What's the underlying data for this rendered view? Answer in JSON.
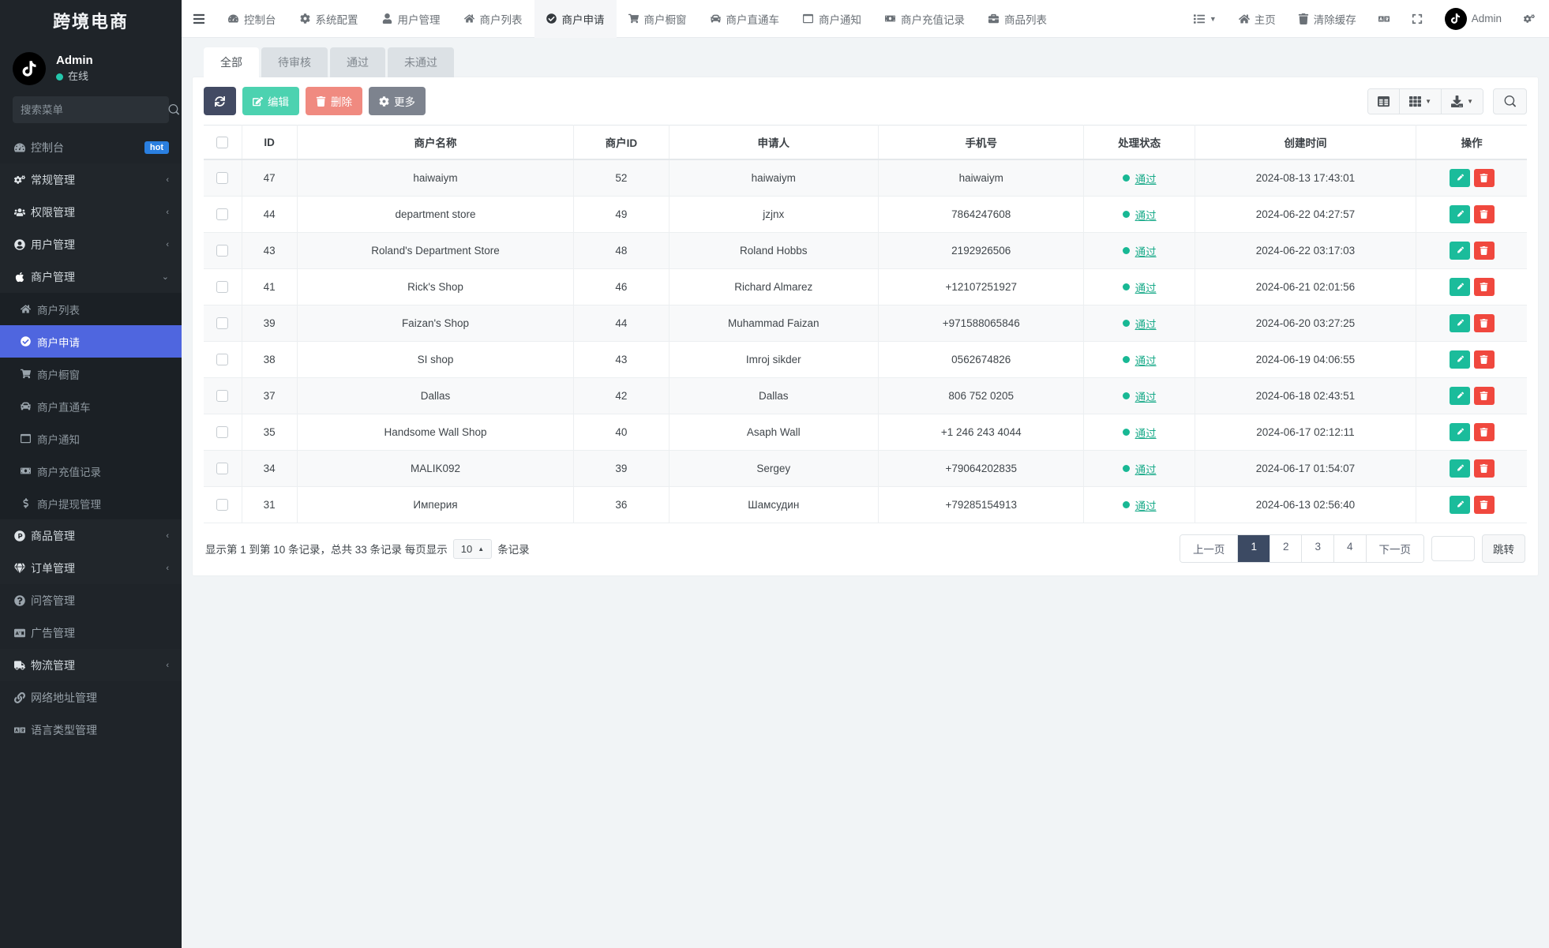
{
  "brand": {
    "title": "跨境电商"
  },
  "user": {
    "name": "Admin",
    "status": "在线",
    "avatar_icon": "tiktok-logo-icon"
  },
  "search": {
    "placeholder": "搜索菜单",
    "value": ""
  },
  "sidebar": {
    "items": [
      {
        "label": "控制台",
        "icon": "dashboard-icon",
        "badge": "hot",
        "type": "item"
      },
      {
        "label": "常规管理",
        "icon": "cogs-icon",
        "caret": "‹",
        "type": "group"
      },
      {
        "label": "权限管理",
        "icon": "users-icon",
        "caret": "‹",
        "type": "group"
      },
      {
        "label": "用户管理",
        "icon": "user-circle-icon",
        "caret": "‹",
        "type": "group"
      },
      {
        "label": "商户管理",
        "icon": "apple-icon",
        "caret": "⌄",
        "type": "group-open"
      },
      {
        "label": "商户列表",
        "icon": "home-icon",
        "type": "sub"
      },
      {
        "label": "商户申请",
        "icon": "check-circle-icon",
        "type": "sub-active"
      },
      {
        "label": "商户橱窗",
        "icon": "cart-icon",
        "type": "sub"
      },
      {
        "label": "商户直通车",
        "icon": "car-icon",
        "type": "sub"
      },
      {
        "label": "商户通知",
        "icon": "window-icon",
        "type": "sub"
      },
      {
        "label": "商户充值记录",
        "icon": "money-icon",
        "type": "sub"
      },
      {
        "label": "商户提现管理",
        "icon": "dollar-icon",
        "type": "sub"
      },
      {
        "label": "商品管理",
        "icon": "p-circle-icon",
        "caret": "‹",
        "type": "group"
      },
      {
        "label": "订单管理",
        "icon": "gem-icon",
        "caret": "‹",
        "type": "group"
      },
      {
        "label": "问答管理",
        "icon": "question-circle-icon",
        "type": "item"
      },
      {
        "label": "广告管理",
        "icon": "ad-icon",
        "type": "item"
      },
      {
        "label": "物流管理",
        "icon": "truck-icon",
        "caret": "‹",
        "type": "group"
      },
      {
        "label": "网络地址管理",
        "icon": "link-icon",
        "type": "item"
      },
      {
        "label": "语言类型管理",
        "icon": "language-icon",
        "type": "item"
      }
    ]
  },
  "topnav": {
    "menu_icon": "hamburger-icon",
    "tabs": [
      {
        "label": "控制台",
        "icon": "dashboard-icon",
        "active": false
      },
      {
        "label": "系统配置",
        "icon": "gear-icon",
        "active": false
      },
      {
        "label": "用户管理",
        "icon": "user-icon",
        "active": false
      },
      {
        "label": "商户列表",
        "icon": "home-icon",
        "active": false
      },
      {
        "label": "商户申请",
        "icon": "check-circle-icon",
        "active": true
      },
      {
        "label": "商户橱窗",
        "icon": "cart-icon",
        "active": false
      },
      {
        "label": "商户直通车",
        "icon": "car-icon",
        "active": false
      },
      {
        "label": "商户通知",
        "icon": "window-icon",
        "active": false
      },
      {
        "label": "商户充值记录",
        "icon": "money-icon",
        "active": false
      },
      {
        "label": "商品列表",
        "icon": "briefcase-icon",
        "active": false
      }
    ],
    "right": {
      "list_label": "",
      "home_label": "主页",
      "clear_cache_label": "清除缓存",
      "lang_icon": "language-icon",
      "fullscreen_icon": "expand-icon",
      "admin_label": "Admin",
      "settings_icon": "cogs-icon"
    }
  },
  "tabs": [
    {
      "label": "全部",
      "active": true
    },
    {
      "label": "待审核",
      "active": false
    },
    {
      "label": "通过",
      "active": false
    },
    {
      "label": "未通过",
      "active": false
    }
  ],
  "toolbar": {
    "refresh_icon": "refresh-icon",
    "edit_label": "编辑",
    "delete_label": "删除",
    "more_label": "更多",
    "column_icon": "columns-icon",
    "grid_icon": "grid-icon",
    "export_icon": "export-icon",
    "search_icon": "search-icon"
  },
  "table": {
    "columns": [
      "",
      "ID",
      "商户名称",
      "商户ID",
      "申请人",
      "手机号",
      "处理状态",
      "创建时间",
      "操作"
    ],
    "rows": [
      {
        "id": "47",
        "name": "haiwaiym",
        "merchant_id": "52",
        "applicant": "haiwaiym",
        "phone": "haiwaiym",
        "status": "通过",
        "created": "2024-08-13 17:43:01"
      },
      {
        "id": "44",
        "name": "department store",
        "merchant_id": "49",
        "applicant": "jzjnx",
        "phone": "7864247608",
        "status": "通过",
        "created": "2024-06-22 04:27:57"
      },
      {
        "id": "43",
        "name": "Roland's Department Store",
        "merchant_id": "48",
        "applicant": "Roland Hobbs",
        "phone": "2192926506",
        "status": "通过",
        "created": "2024-06-22 03:17:03"
      },
      {
        "id": "41",
        "name": "Rick's Shop",
        "merchant_id": "46",
        "applicant": "Richard Almarez",
        "phone": "+12107251927",
        "status": "通过",
        "created": "2024-06-21 02:01:56"
      },
      {
        "id": "39",
        "name": "Faizan's Shop",
        "merchant_id": "44",
        "applicant": "Muhammad Faizan",
        "phone": "+971588065846",
        "status": "通过",
        "created": "2024-06-20 03:27:25"
      },
      {
        "id": "38",
        "name": "SI shop",
        "merchant_id": "43",
        "applicant": "Imroj sikder",
        "phone": "0562674826",
        "status": "通过",
        "created": "2024-06-19 04:06:55"
      },
      {
        "id": "37",
        "name": "Dallas",
        "merchant_id": "42",
        "applicant": "Dallas",
        "phone": "806 752 0205",
        "status": "通过",
        "created": "2024-06-18 02:43:51"
      },
      {
        "id": "35",
        "name": "Handsome Wall Shop",
        "merchant_id": "40",
        "applicant": "Asaph Wall",
        "phone": "+1 246 243 4044",
        "status": "通过",
        "created": "2024-06-17 02:12:11"
      },
      {
        "id": "34",
        "name": "MALIK092",
        "merchant_id": "39",
        "applicant": "Sergey",
        "phone": "+79064202835",
        "status": "通过",
        "created": "2024-06-17 01:54:07"
      },
      {
        "id": "31",
        "name": "Империя",
        "merchant_id": "36",
        "applicant": "Шамсудин",
        "phone": "+79285154913",
        "status": "通过",
        "created": "2024-06-13 02:56:40"
      }
    ]
  },
  "footer": {
    "info_prefix": "显示第 1 到第 10 条记录，总共 33 条记录 每页显示",
    "page_size": "10",
    "info_suffix": "条记录",
    "prev_label": "上一页",
    "pages": [
      "1",
      "2",
      "3",
      "4"
    ],
    "current_page": "1",
    "next_label": "下一页",
    "jump_value": "",
    "jump_label": "跳转"
  },
  "colors": {
    "sidebar_bg": "#1f2429",
    "active_menu": "#4f66df",
    "status_green": "#1aab8a",
    "edit_green": "#1bbc9b",
    "delete_red": "#f0483e",
    "pager_active": "#3c4a63"
  }
}
